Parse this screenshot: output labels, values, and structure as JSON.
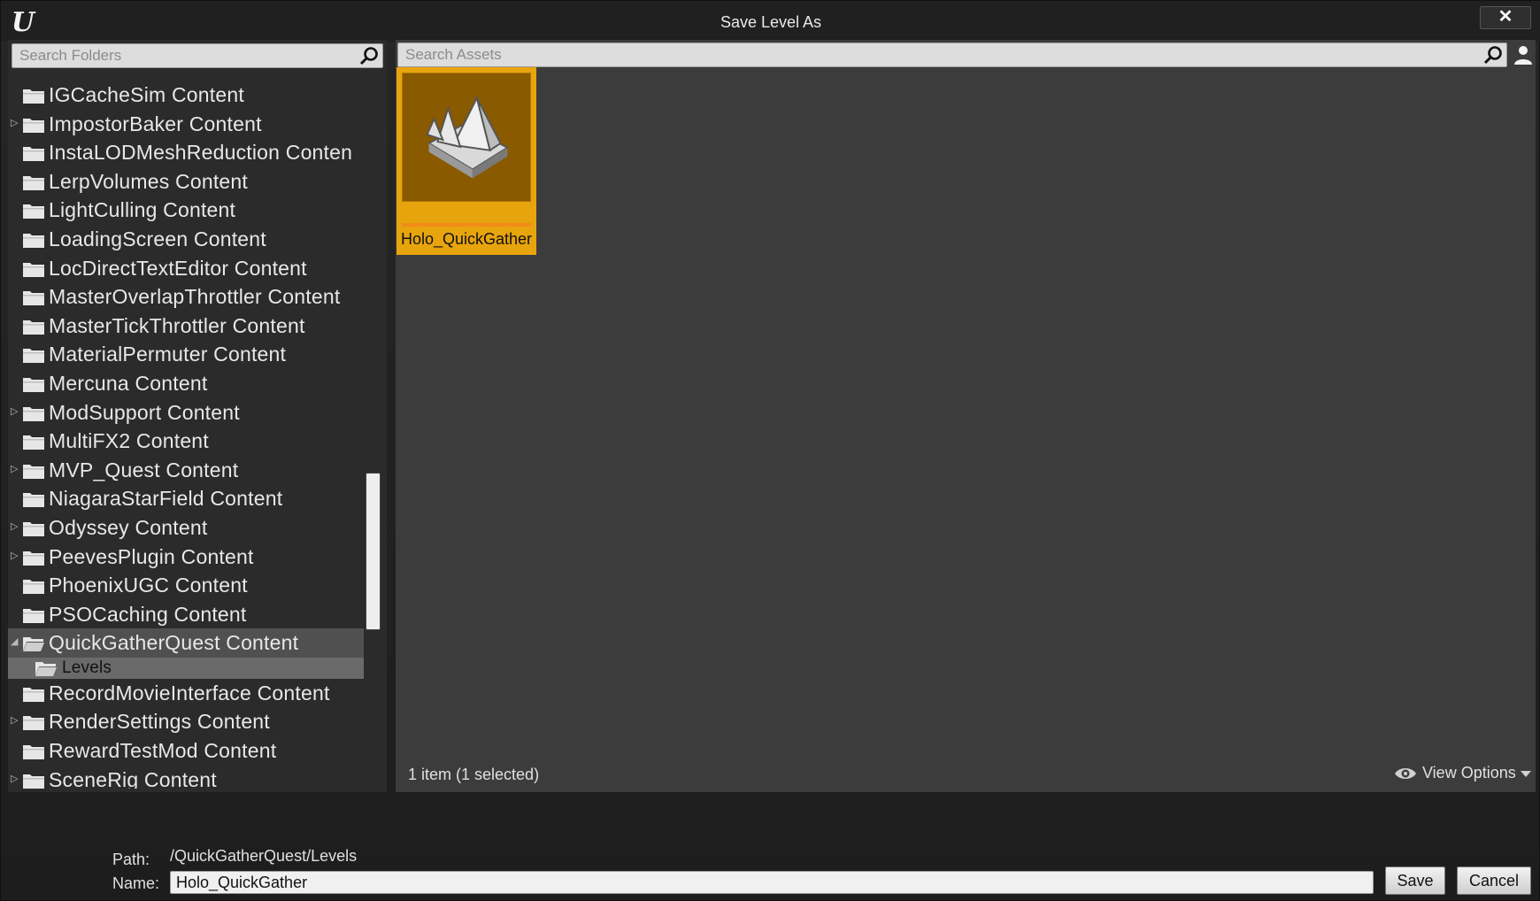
{
  "window": {
    "title": "Save Level As"
  },
  "left_panel": {
    "search_placeholder": "Search Folders",
    "folders": [
      {
        "label": "IGCacheSim Content",
        "expandable": false
      },
      {
        "label": "ImpostorBaker Content",
        "expandable": true
      },
      {
        "label": "InstaLODMeshReduction Conten",
        "expandable": false
      },
      {
        "label": "LerpVolumes Content",
        "expandable": false
      },
      {
        "label": "LightCulling Content",
        "expandable": false
      },
      {
        "label": "LoadingScreen Content",
        "expandable": false
      },
      {
        "label": "LocDirectTextEditor Content",
        "expandable": false
      },
      {
        "label": "MasterOverlapThrottler Content",
        "expandable": false
      },
      {
        "label": "MasterTickThrottler Content",
        "expandable": false
      },
      {
        "label": "MaterialPermuter Content",
        "expandable": false
      },
      {
        "label": "Mercuna Content",
        "expandable": false
      },
      {
        "label": "ModSupport Content",
        "expandable": true
      },
      {
        "label": "MultiFX2 Content",
        "expandable": false
      },
      {
        "label": "MVP_Quest Content",
        "expandable": true
      },
      {
        "label": "NiagaraStarField Content",
        "expandable": false
      },
      {
        "label": "Odyssey Content",
        "expandable": true
      },
      {
        "label": "PeevesPlugin Content",
        "expandable": true
      },
      {
        "label": "PhoenixUGC Content",
        "expandable": false
      },
      {
        "label": "PSOCaching Content",
        "expandable": false
      },
      {
        "label": "QuickGatherQuest Content",
        "expandable": true,
        "expanded": true,
        "highlighted": true
      },
      {
        "label": "Levels",
        "child": true,
        "selected": true
      },
      {
        "label": "RecordMovieInterface Content",
        "expandable": false
      },
      {
        "label": "RenderSettings Content",
        "expandable": true
      },
      {
        "label": "RewardTestMod Content",
        "expandable": false
      },
      {
        "label": "SceneRig Content",
        "expandable": true
      }
    ]
  },
  "right_panel": {
    "search_placeholder": "Search Assets",
    "assets": [
      {
        "name": "Holo_QuickGather",
        "icon": "level-map-icon",
        "selected": true
      }
    ],
    "item_count": "1 item (1 selected)",
    "view_options_label": "View Options"
  },
  "footer": {
    "path_label": "Path:",
    "path_value": "/QuickGatherQuest/Levels",
    "name_label": "Name:",
    "name_value": "Holo_QuickGather",
    "save_label": "Save",
    "cancel_label": "Cancel"
  },
  "colors": {
    "accent_selected": "#e7a40c",
    "panel_bg": "#3c3c3c",
    "tree_bg": "#2b2b2b"
  }
}
